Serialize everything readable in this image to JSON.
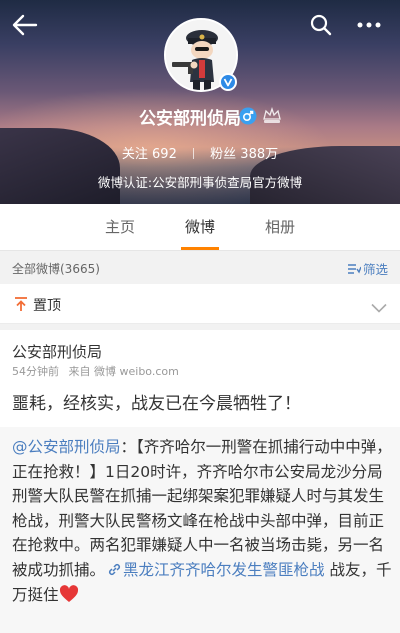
{
  "header": {
    "back_icon": "arrow-left-icon",
    "search_icon": "search-icon",
    "more_icon": "more-dots-icon",
    "avatar_icon": "police-cartoon-avatar",
    "verify_badge_icon": "verified-v-icon",
    "verify_badge_color": "#2e8ae6",
    "name": "公安部刑侦局",
    "gender_icon": "male-icon",
    "level_icon": "crown-level-icon",
    "following_label": "关注",
    "following_count": "692",
    "fans_label": "粉丝",
    "fans_count": "388万",
    "verification": "微博认证:公安部刑事侦查局官方微博"
  },
  "tabs": [
    {
      "label": "主页",
      "active": false
    },
    {
      "label": "微博",
      "active": true
    },
    {
      "label": "相册",
      "active": false
    }
  ],
  "accent_color": "#ff8200",
  "link_color": "#4b7ebf",
  "filter_bar": {
    "all_weibo": "全部微博(3665)",
    "filter_label": "筛选",
    "filter_icon": "filter-list-icon"
  },
  "pinned": {
    "icon": "pin-arrow-icon",
    "label": "置顶",
    "chevron": "chevron-down-icon"
  },
  "post": {
    "author": "公安部刑侦局",
    "time": "54分钟前",
    "source_prefix": "来自",
    "source": "微博 weibo.com",
    "text": "噩耗，经核实，战友已在今晨牺牲了！",
    "repost": {
      "mention": "@公安部刑侦局",
      "colon": "：",
      "body": "【齐齐哈尔一刑警在抓捕行动中中弹，正在抢救！】1日20时许，齐齐哈尔市公安局龙沙分局刑警大队民警在抓捕一起绑架案犯罪嫌疑人时与其发生枪战，刑警大队民警杨文峰在枪战中头部中弹，目前正在抢救中。两名犯罪嫌疑人中一名被当场击毙，另一名被成功抓捕。",
      "topic_icon": "link-icon",
      "topic": "黑龙江齐齐哈尔发生警匪枪战",
      "tail": " 战友，千万挺住",
      "heart_icon": "heart-icon"
    }
  }
}
